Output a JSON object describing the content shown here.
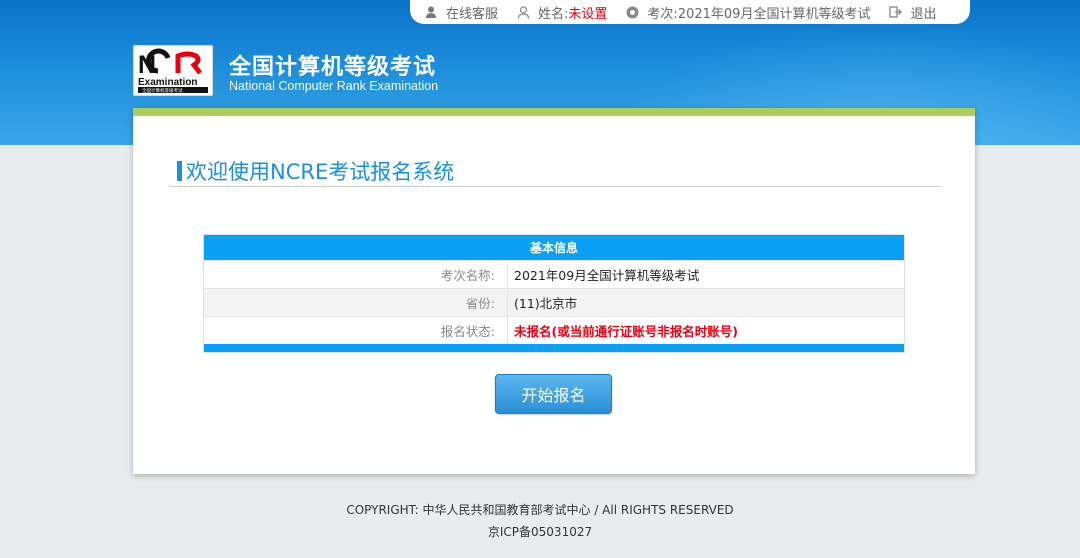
{
  "topbar": {
    "service_label": "在线客服",
    "name_label": "姓名:",
    "name_value": "未设置",
    "exam_label": "考次:",
    "exam_value": "2021年09月全国计算机等级考试",
    "logout_label": "退出"
  },
  "brand": {
    "title": "全国计算机等级考试",
    "subtitle": "National Computer Rank Examination",
    "logo_text": "Examination",
    "logo_small": "全国计算机等级考试"
  },
  "main": {
    "welcome": "欢迎使用NCRE考试报名系统",
    "info_title": "基本信息",
    "rows": [
      {
        "key": "考次名称:",
        "value": "2021年09月全国计算机等级考试"
      },
      {
        "key": "省份:",
        "value": "(11)北京市"
      },
      {
        "key": "报名状态:",
        "value": "未报名(或当前通行证账号非报名时账号)"
      }
    ],
    "start_button": "开始报名"
  },
  "footer": {
    "copyright": "COPYRIGHT: 中华人民共和国教育部考试中心 / All RIGHTS RESERVED",
    "icp": "京ICP备05031027"
  },
  "colors": {
    "header_blue": "#1c8ddb",
    "accent_green": "#a9cf5b",
    "table_blue": "#0aa0f5",
    "alert_red": "#e60012"
  }
}
